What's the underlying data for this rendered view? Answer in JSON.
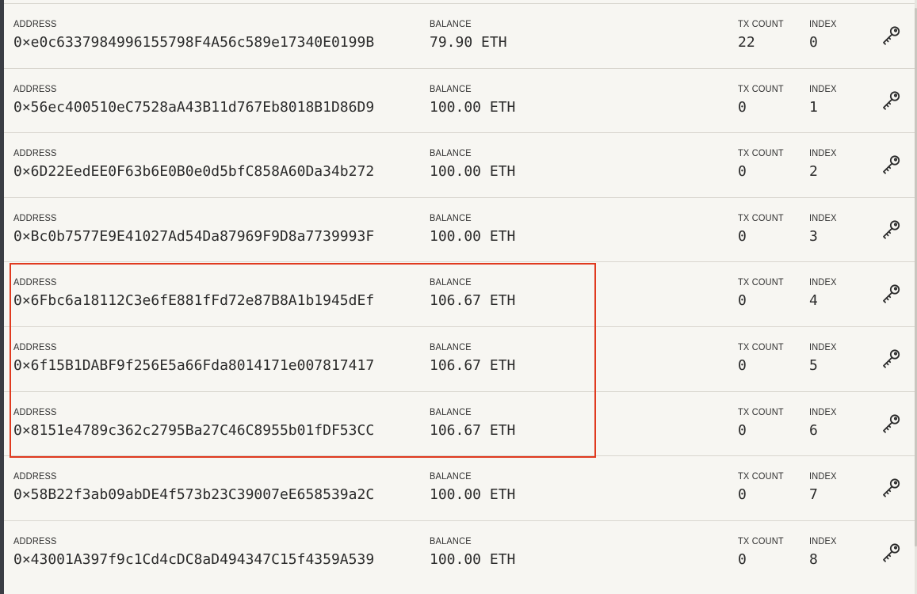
{
  "labels": {
    "address": "ADDRESS",
    "balance": "BALANCE",
    "tx_count": "TX COUNT",
    "index": "INDEX"
  },
  "accounts": [
    {
      "address": "0×e0c6337984996155798F4A56c589e17340E0199B",
      "balance": "79.90 ETH",
      "tx_count": "22",
      "index": "0"
    },
    {
      "address": "0×56ec400510eC7528aA43B11d767Eb8018B1D86D9",
      "balance": "100.00 ETH",
      "tx_count": "0",
      "index": "1"
    },
    {
      "address": "0×6D22EedEE0F63b6E0B0e0d5bfC858A60Da34b272",
      "balance": "100.00 ETH",
      "tx_count": "0",
      "index": "2"
    },
    {
      "address": "0×Bc0b7577E9E41027Ad54Da87969F9D8a7739993F",
      "balance": "100.00 ETH",
      "tx_count": "0",
      "index": "3"
    },
    {
      "address": "0×6Fbc6a18112C3e6fE881fFd72e87B8A1b1945dEf",
      "balance": "106.67 ETH",
      "tx_count": "0",
      "index": "4"
    },
    {
      "address": "0×6f15B1DABF9f256E5a66Fda8014171e007817417",
      "balance": "106.67 ETH",
      "tx_count": "0",
      "index": "5"
    },
    {
      "address": "0×8151e4789c362c2795Ba27C46C8955b01fDF53CC",
      "balance": "106.67 ETH",
      "tx_count": "0",
      "index": "6"
    },
    {
      "address": "0×58B22f3ab09abDE4f573b23C39007eE658539a2C",
      "balance": "100.00 ETH",
      "tx_count": "0",
      "index": "7"
    },
    {
      "address": "0×43001A397f9c1Cd4cDC8aD494347C15f4359A539",
      "balance": "100.00 ETH",
      "tx_count": "0",
      "index": "8"
    }
  ],
  "icons": {
    "key": "key-icon"
  },
  "colors": {
    "background": "#f7f6f2",
    "highlight_border": "#e03a1f",
    "text": "#2b2b2b"
  }
}
